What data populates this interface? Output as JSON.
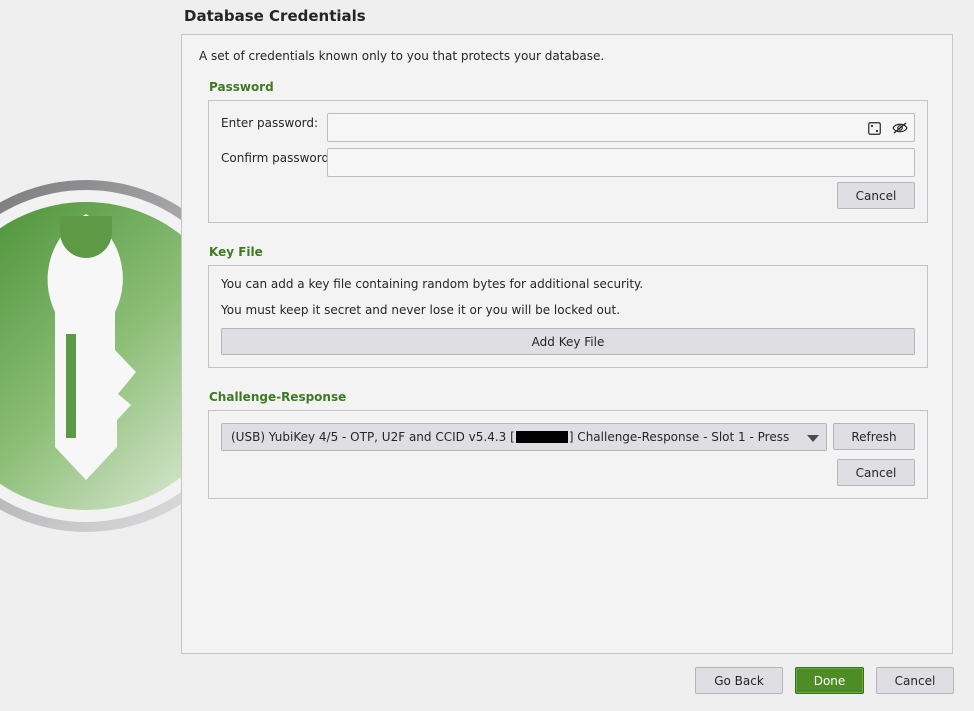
{
  "dialog": {
    "title": "Database Credentials",
    "intro": "A set of credentials known only to you that protects your database."
  },
  "password": {
    "section_title": "Password",
    "enter_label": "Enter password:",
    "confirm_label": "Confirm password:",
    "enter_value": "",
    "confirm_value": "",
    "generator_icon": "dice-icon",
    "visibility_icon": "eye-off-icon",
    "cancel_label": "Cancel"
  },
  "key_file": {
    "section_title": "Key File",
    "line1": "You can add a key file containing random bytes for additional security.",
    "line2": "You must keep it secret and never lose it or you will be locked out.",
    "add_label": "Add Key File"
  },
  "challenge": {
    "section_title": "Challenge-Response",
    "device_prefix": "(USB) YubiKey 4/5 - OTP, U2F and CCID v5.4.3 [",
    "device_suffix": "] Challenge-Response - Slot 1 - Press",
    "refresh_label": "Refresh",
    "cancel_label": "Cancel"
  },
  "footer": {
    "back_label": "Go Back",
    "done_label": "Done",
    "cancel_label": "Cancel"
  },
  "colors": {
    "accent": "#3e7a21",
    "done_button": "#4e8c26",
    "background": "#efeff0"
  }
}
